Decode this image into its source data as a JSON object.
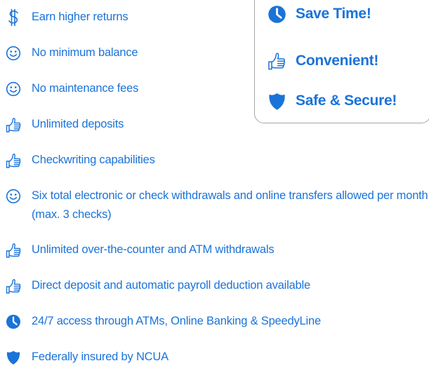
{
  "brand_color": "#1a73d9",
  "features": [
    {
      "icon": "dollar-icon",
      "text": "Earn higher returns"
    },
    {
      "icon": "smiley-icon",
      "text": "No minimum balance"
    },
    {
      "icon": "smiley-icon",
      "text": "No maintenance fees"
    },
    {
      "icon": "thumbs-up-icon",
      "text": "Unlimited deposits"
    },
    {
      "icon": "thumbs-up-icon",
      "text": "Checkwriting capabilities"
    },
    {
      "icon": "smiley-icon",
      "text": "Six total electronic or check withdrawals and online transfers allowed per month (max. 3 checks)"
    },
    {
      "icon": "thumbs-up-icon",
      "text": "Unlimited over-the-counter and ATM withdrawals"
    },
    {
      "icon": "thumbs-up-icon",
      "text": "Direct deposit and automatic payroll deduction available"
    },
    {
      "icon": "clock-icon",
      "text": "24/7 access through ATMs, Online Banking & SpeedyLine"
    },
    {
      "icon": "shield-icon",
      "text": "Federally insured by NCUA"
    }
  ],
  "highlights": [
    {
      "icon": "clock-icon",
      "text": "Save Time!"
    },
    {
      "icon": "thumbs-up-icon",
      "text": "Convenient!"
    },
    {
      "icon": "shield-icon",
      "text": "Safe & Secure!"
    }
  ]
}
